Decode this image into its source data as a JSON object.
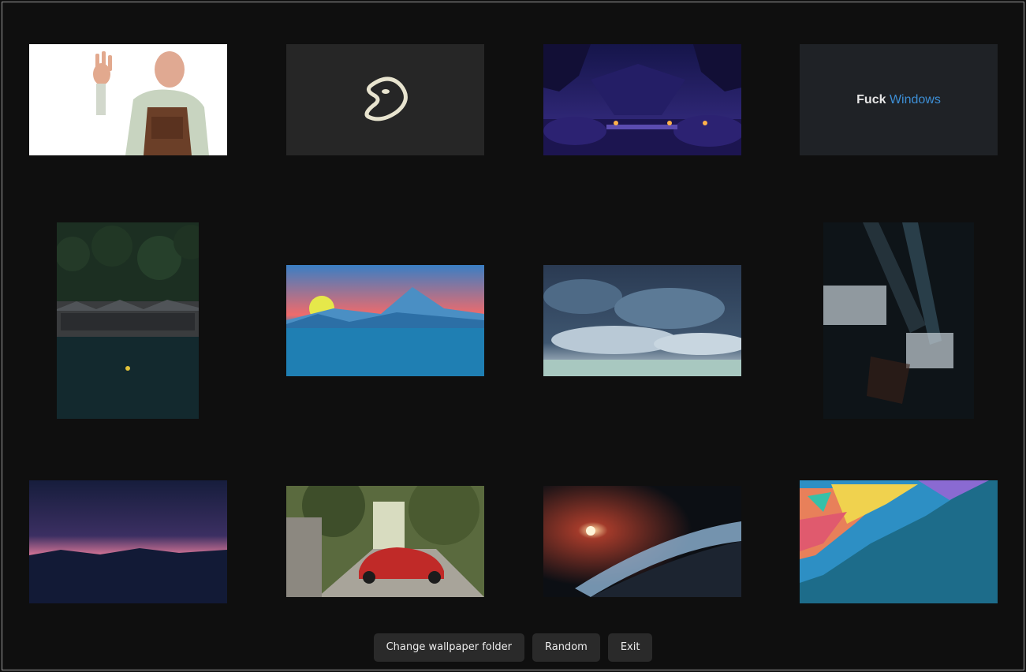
{
  "wallpapers": [
    {
      "name": "ok-gesture-man",
      "caption": ""
    },
    {
      "name": "gentoo-logo",
      "caption": ""
    },
    {
      "name": "purple-cave-scene",
      "caption": ""
    },
    {
      "name": "text-wallpaper",
      "caption_bold": "Fuck",
      "caption_accent": "Windows"
    },
    {
      "name": "lakeside-village",
      "caption": ""
    },
    {
      "name": "sunset-mountain-lake",
      "caption": ""
    },
    {
      "name": "stormy-sky-anime",
      "caption": ""
    },
    {
      "name": "light-beams-architecture",
      "caption": ""
    },
    {
      "name": "night-dusk-mountains",
      "caption": ""
    },
    {
      "name": "red-sports-car",
      "caption": ""
    },
    {
      "name": "space-planet-flare",
      "caption": ""
    },
    {
      "name": "hexagon-gradient",
      "caption": ""
    }
  ],
  "buttons": {
    "change_folder": "Change wallpaper folder",
    "random": "Random",
    "exit": "Exit"
  },
  "colors": {
    "background": "#0f0f0f",
    "button_bg": "#2a2a2a",
    "button_text": "#ececec",
    "accent_blue": "#3d8fd6"
  }
}
